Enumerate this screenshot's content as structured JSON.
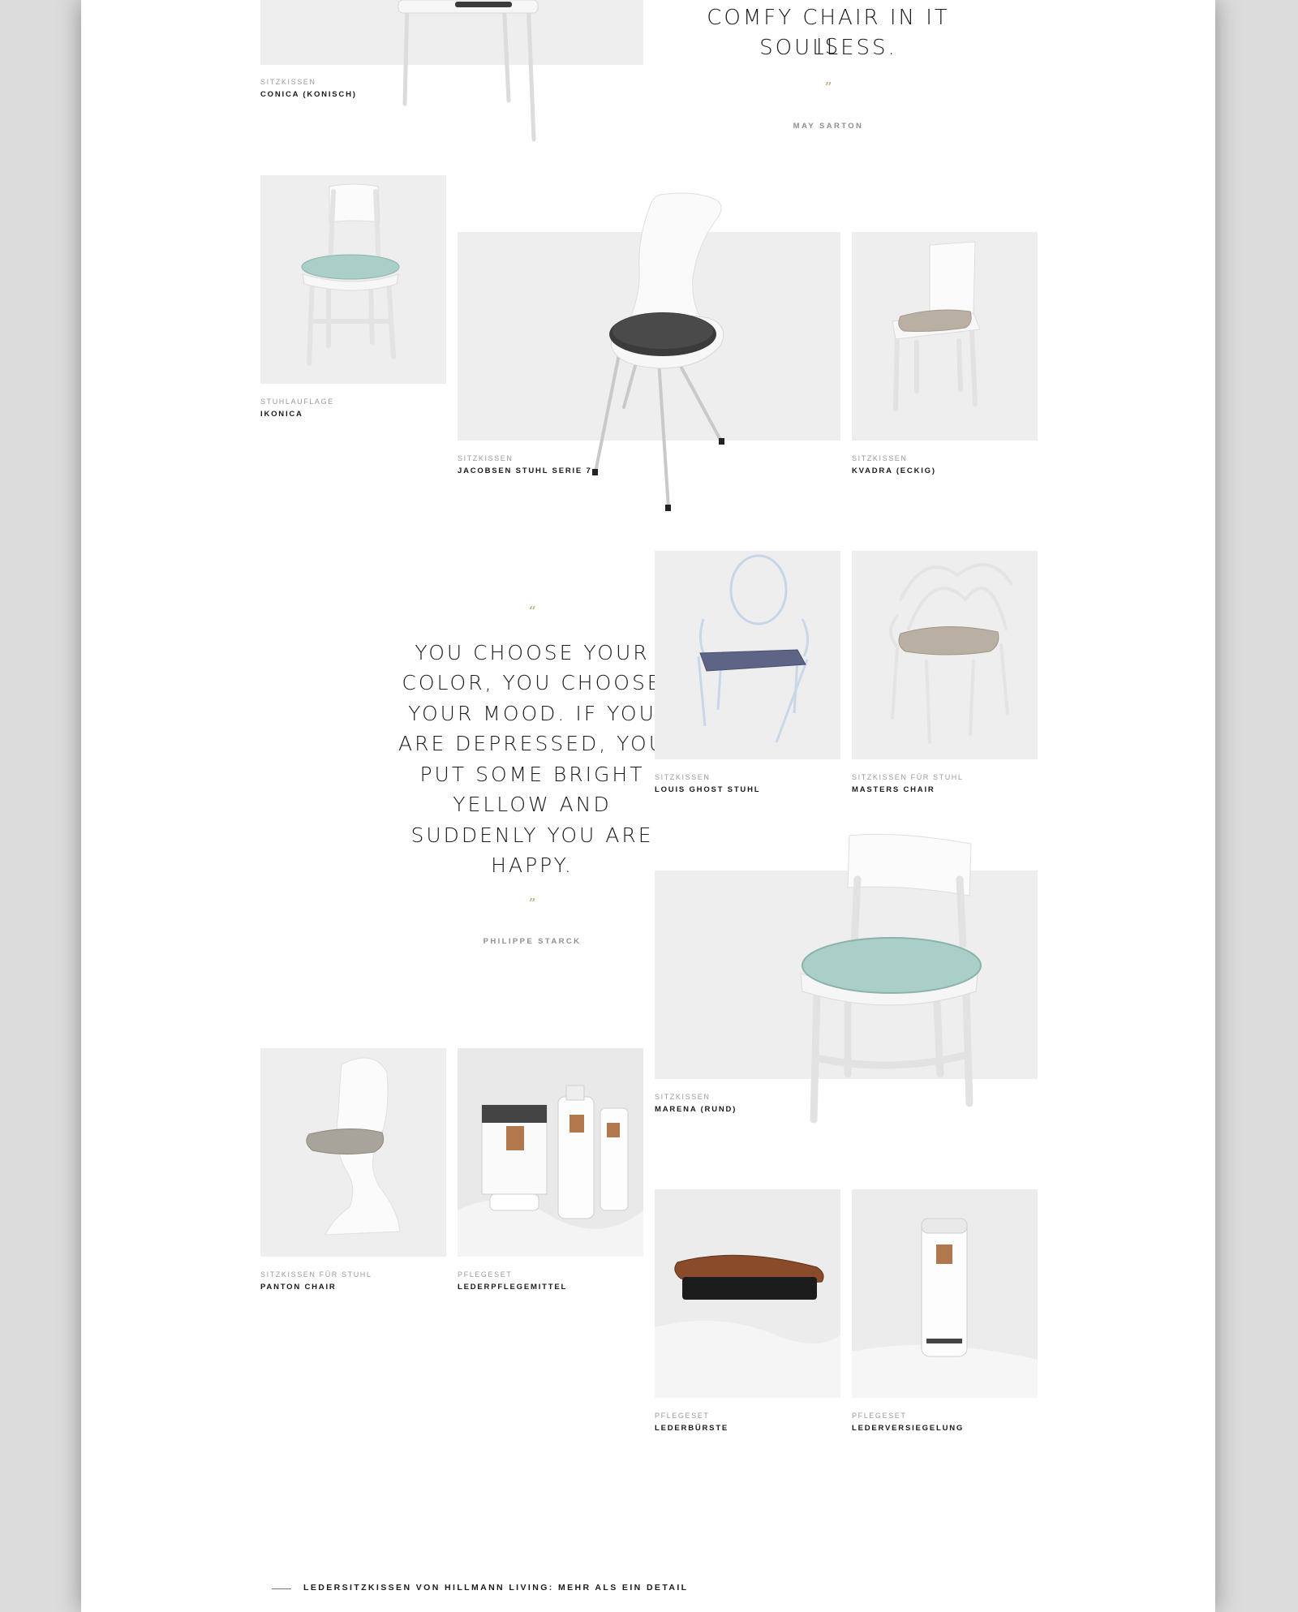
{
  "quotes": {
    "top": {
      "text_line1": "COMFY CHAIR IN IT IS",
      "text_line2": "SOULLESS.",
      "close_mark": "”",
      "author": "MAY SARTON"
    },
    "middle": {
      "open_mark": "“",
      "lines": [
        "YOU CHOOSE YOUR",
        "COLOR, YOU CHOOSE",
        "YOUR MOOD. IF YOU",
        "ARE DEPRESSED, YOU",
        "PUT SOME BRIGHT",
        "YELLOW AND",
        "SUDDENLY YOU ARE",
        "HAPPY."
      ],
      "close_mark": "”",
      "author": "PHILIPPE STARCK"
    }
  },
  "products": {
    "conica": {
      "category": "SITZKISSEN",
      "name": "CONICA (KONISCH)"
    },
    "ikonica": {
      "category": "STUHLAUFLAGE",
      "name": "IKONICA"
    },
    "jacobsen": {
      "category": "SITZKISSEN",
      "name": "JACOBSEN STUHL SERIE 7"
    },
    "kvadra": {
      "category": "SITZKISSEN",
      "name": "KVADRA (ECKIG)"
    },
    "louis": {
      "category": "SITZKISSEN",
      "name": "LOUIS GHOST STUHL"
    },
    "masters": {
      "category": "SITZKISSEN FÜR STUHL",
      "name": "MASTERS CHAIR"
    },
    "marena": {
      "category": "SITZKISSEN",
      "name": "MARENA (RUND)"
    },
    "panton": {
      "category": "SITZKISSEN FÜR STUHL",
      "name": "PANTON CHAIR"
    },
    "lederpflegemittel": {
      "category": "PFLEGESET",
      "name": "LEDERPFLEGEMITTEL"
    },
    "lederbuerste": {
      "category": "PFLEGESET",
      "name": "LEDERBÜRSTE"
    },
    "lederversiegelung": {
      "category": "PFLEGESET",
      "name": "LEDERVERSIEGELUNG"
    }
  },
  "footer": {
    "heading": "LEDERSITZKISSEN VON HILLMANN LIVING: MEHR ALS EIN DETAIL"
  },
  "colors": {
    "accent_quote_mark": "#c1a57c",
    "tile_background": "#eeeeee",
    "cushion_mint": "#a9cfc8",
    "cushion_dark": "#3b3b3b",
    "cushion_taupe": "#b9b0a3",
    "cushion_navy": "#5d6485"
  }
}
